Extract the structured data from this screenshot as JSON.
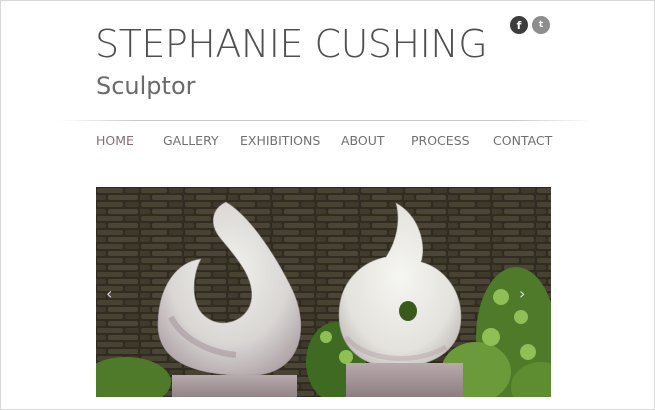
{
  "header": {
    "title": "STEPHANIE CUSHING",
    "subtitle": "Sculptor"
  },
  "social": [
    {
      "name": "facebook-icon",
      "glyph": "f"
    },
    {
      "name": "twitter-icon",
      "glyph": "t"
    }
  ],
  "nav": {
    "items": [
      {
        "label": "HOME",
        "active": true
      },
      {
        "label": "GALLERY"
      },
      {
        "label": "EXHIBITIONS"
      },
      {
        "label": "ABOUT"
      },
      {
        "label": "PROCESS"
      },
      {
        "label": "CONTACT"
      }
    ]
  },
  "slideshow": {
    "prev_glyph": "‹",
    "next_glyph": "›",
    "image_subject": "two white marble spiral sculptures on stone plinths before a dry stone wall"
  },
  "colors": {
    "text": "#555555",
    "nav_active": "#8a6a77",
    "facebook": "#3d3d3d",
    "twitter": "#8e8e8e"
  }
}
